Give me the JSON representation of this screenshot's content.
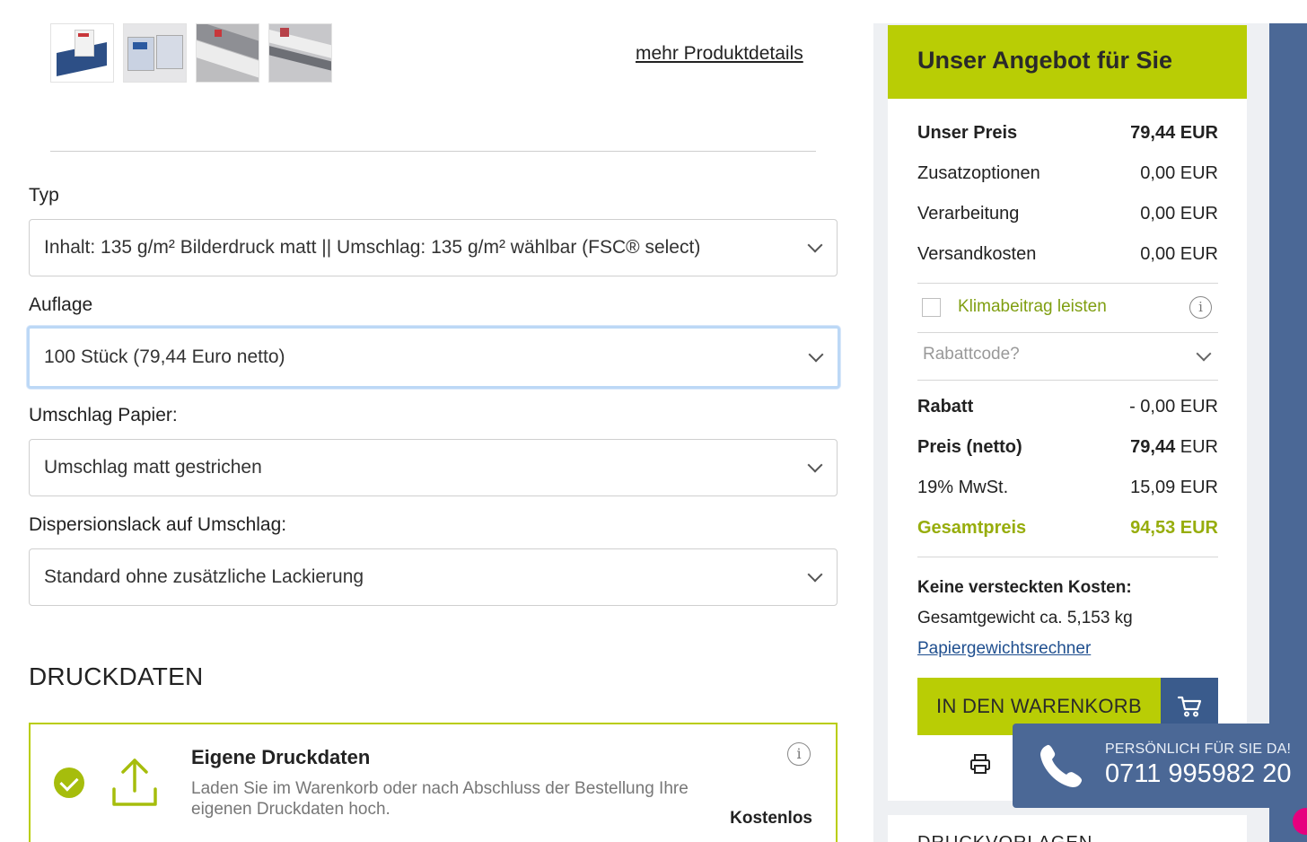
{
  "product": {
    "thumbnails": [
      "product-thumbnail-1",
      "product-thumbnail-2",
      "product-thumbnail-3",
      "product-thumbnail-4"
    ],
    "more_details_link": "mehr Produktdetails"
  },
  "config": {
    "typ": {
      "label": "Typ",
      "value": "Inhalt: 135 g/m² Bilderdruck matt || Umschlag: 135 g/m² wählbar (FSC® select)"
    },
    "auflage": {
      "label": "Auflage",
      "value": "100 Stück (79,44 Euro netto)"
    },
    "umschlag_papier": {
      "label": "Umschlag Papier:",
      "value": "Umschlag matt gestrichen"
    },
    "dispersionslack": {
      "label": "Dispersionslack auf Umschlag:",
      "value": "Standard ohne zusätzliche Lackierung"
    }
  },
  "druckdaten": {
    "section_title": "DRUCKDATEN",
    "option_title": "Eigene Druckdaten",
    "option_description": "Laden Sie im Warenkorb oder nach Abschluss der Bestellung Ihre eigenen Druckdaten hoch.",
    "option_price": "Kostenlos",
    "info_icon": "i"
  },
  "offer": {
    "title": "Unser Angebot für Sie",
    "rows": [
      {
        "label": "Unser Preis",
        "value": "79,44 EUR"
      },
      {
        "label": "Zusatzoptionen",
        "value": "0,00 EUR"
      },
      {
        "label": "Verarbeitung",
        "value": "0,00 EUR"
      },
      {
        "label": "Versandkosten",
        "value": "0,00 EUR"
      }
    ],
    "klima_label": "Klimabeitrag leisten",
    "info_icon": "i",
    "rabatt_placeholder": "Rabattcode?",
    "totals": [
      {
        "label": "Rabatt",
        "value": "- 0,00 EUR"
      },
      {
        "label": "Preis (netto)",
        "value_bold": "79,44",
        "value_unit": " EUR"
      },
      {
        "label": "19% MwSt.",
        "value": "15,09 EUR"
      },
      {
        "label": "Gesamtpreis",
        "value": "94,53 EUR"
      }
    ],
    "costs_title": "Keine versteckten Kosten:",
    "weight_text": "Gesamtgewicht ca. 5,153 kg",
    "calc_link": "Papiergewichtsrechner",
    "cart_button": "IN DEN WARENKORB"
  },
  "contact": {
    "subtitle": "PERSÖNLICH FÜR SIE DA!",
    "phone": "0711 995982 20"
  },
  "next_section": {
    "title": "DRUCKVORLAGEN"
  },
  "colors": {
    "accent_green": "#b9cd05",
    "text_green": "#97ad0c",
    "brand_blue": "#4b6896",
    "pink": "#e6007e"
  }
}
